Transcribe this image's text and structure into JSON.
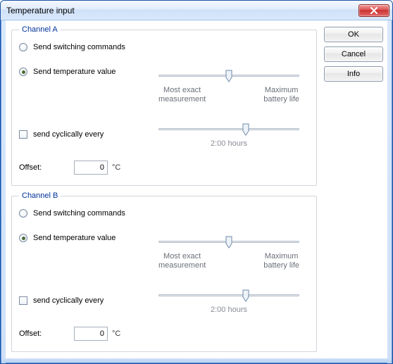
{
  "window": {
    "title": "Temperature input"
  },
  "buttons": {
    "ok": "OK",
    "cancel": "Cancel",
    "info": "Info"
  },
  "channelA": {
    "legend": "Channel A",
    "opt_switch": "Send switching commands",
    "opt_temp": "Send temperature value",
    "slider_left": "Most exact\nmeasurement",
    "slider_right": "Maximum\nbattery life",
    "cyclic_label": "send cyclically every",
    "cyclic_value": "2:00 hours",
    "offset_label": "Offset:",
    "offset_value": "0",
    "offset_unit": "°C"
  },
  "channelB": {
    "legend": "Channel B",
    "opt_switch": "Send switching commands",
    "opt_temp": "Send temperature value",
    "slider_left": "Most exact\nmeasurement",
    "slider_right": "Maximum\nbattery life",
    "cyclic_label": "send cyclically every",
    "cyclic_value": "2:00 hours",
    "offset_label": "Offset:",
    "offset_value": "0",
    "offset_unit": "°C"
  }
}
